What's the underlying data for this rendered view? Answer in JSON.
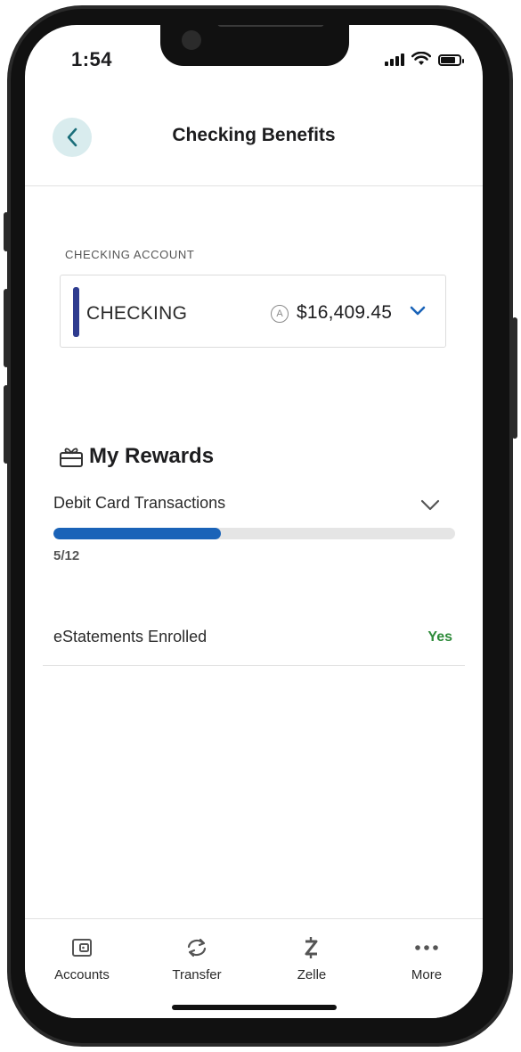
{
  "status_bar": {
    "time": "1:54"
  },
  "header": {
    "title": "Checking Benefits"
  },
  "account": {
    "section_label": "CHECKING ACCOUNT",
    "name": "CHECKING",
    "available_icon": "A",
    "balance": "$16,409.45",
    "accent_color": "#2e3b8f"
  },
  "rewards": {
    "title": "My Rewards",
    "items": [
      {
        "label": "Debit Card Transactions",
        "progress_text": "5/12",
        "progress_fraction": 0.4167
      }
    ],
    "estatements": {
      "label": "eStatements Enrolled",
      "value": "Yes",
      "value_color": "#2e8b3a"
    }
  },
  "tabbar": {
    "tabs": [
      {
        "label": "Accounts",
        "icon": "wallet-icon"
      },
      {
        "label": "Transfer",
        "icon": "transfer-arrows-icon"
      },
      {
        "label": "Zelle",
        "icon": "zelle-icon"
      },
      {
        "label": "More",
        "icon": "more-dots-icon"
      }
    ]
  },
  "colors": {
    "progress": "#1a63b8",
    "back_button_bg": "#d9ecee",
    "back_arrow": "#1a6e7a"
  }
}
